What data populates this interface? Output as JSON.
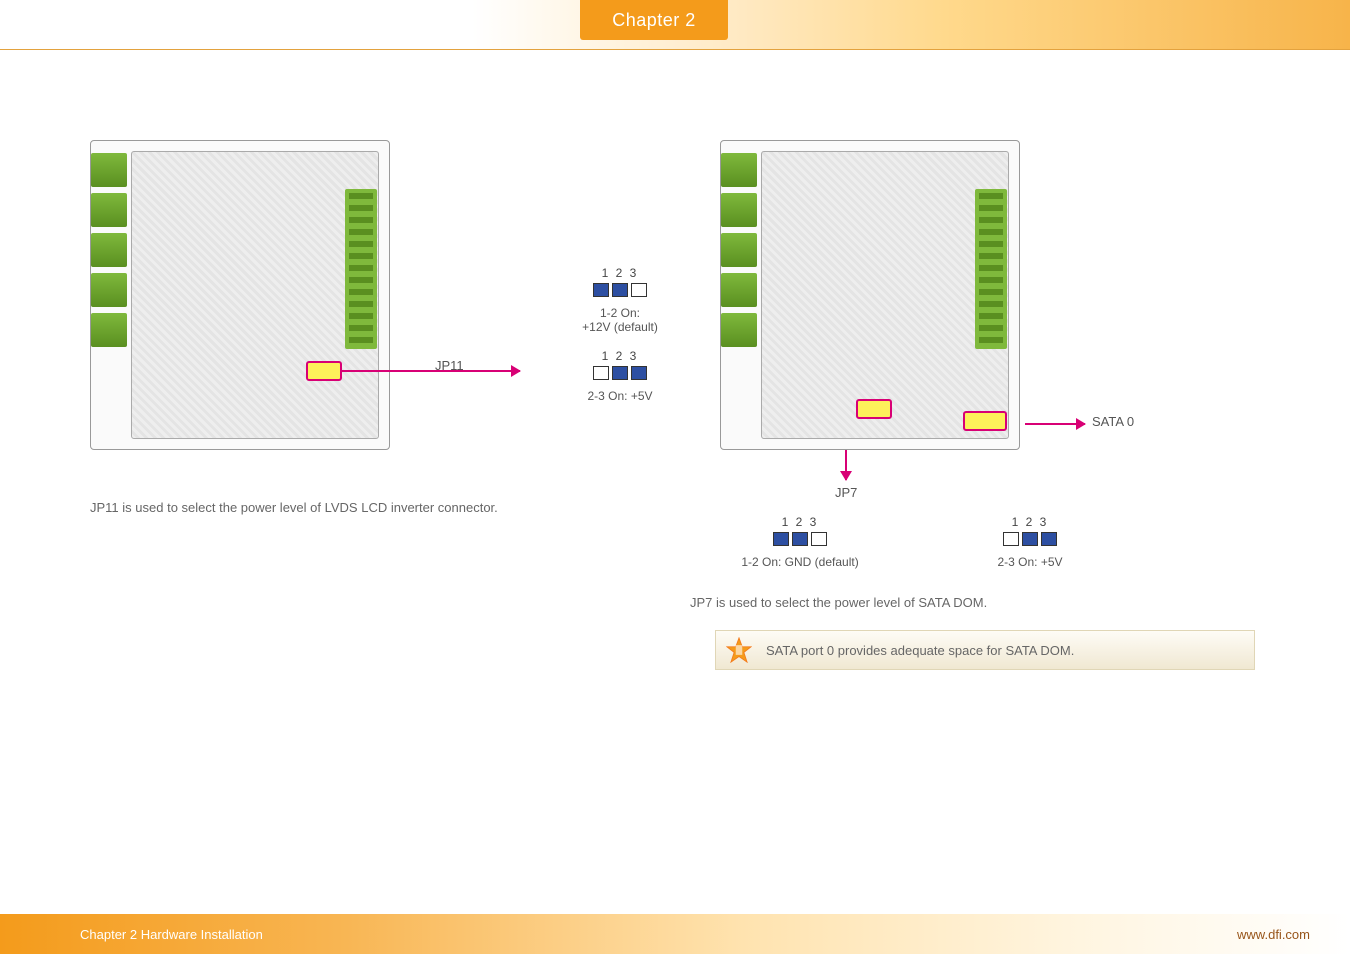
{
  "header": {
    "chapter_tab": "Chapter 2"
  },
  "left": {
    "arrow_label": "JP11",
    "jumper_a": {
      "pins_header": "1  2  3",
      "description": "1-2 On:\n+12V (default)"
    },
    "jumper_b": {
      "pins_header": "1  2  3",
      "description": "2-3 On: +5V"
    },
    "body_text": "JP11 is used to select the power level of LVDS LCD inverter connector."
  },
  "right": {
    "sata_label": "SATA 0",
    "jp7_label": "JP7",
    "jumper_a": {
      "pins_header": "1  2  3",
      "description": "1-2 On: GND (default)"
    },
    "jumper_b": {
      "pins_header": "1  2  3",
      "description": "2-3 On: +5V"
    },
    "body_text": "JP7 is used to select the power level of SATA DOM.",
    "note_text": "SATA port 0 provides adequate space for SATA DOM."
  },
  "footer": {
    "left": "Chapter 2 Hardware Installation",
    "right": "www.dfi.com"
  }
}
